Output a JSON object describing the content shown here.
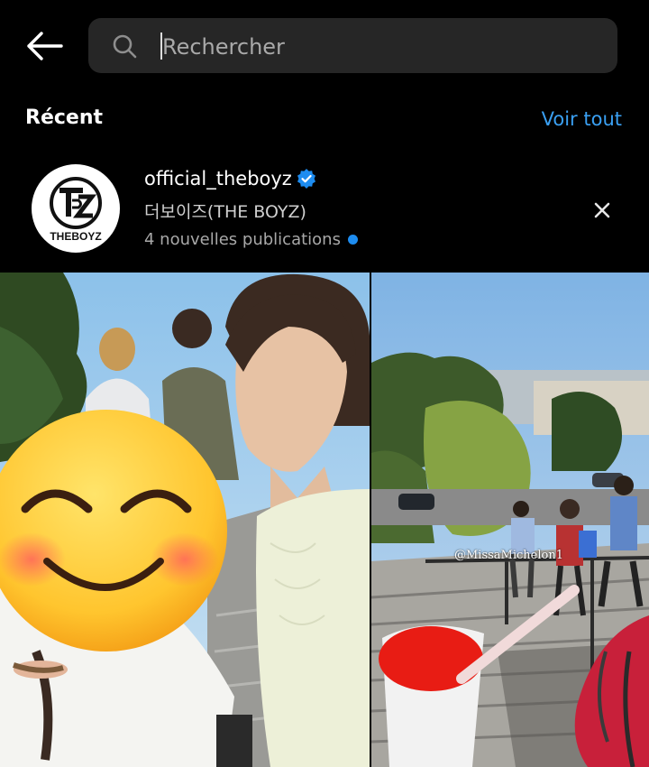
{
  "search": {
    "placeholder": "Rechercher",
    "value": ""
  },
  "recent": {
    "title": "Récent",
    "see_all": "Voir tout",
    "account": {
      "username": "official_theboyz",
      "full_name": "더보이즈(THE BOYZ)",
      "new_posts": "4 nouvelles publications",
      "avatar_logo_text": "THEBOYZ",
      "verified": true
    }
  },
  "results": {
    "tiles": [
      {
        "description": "selfie-photo"
      },
      {
        "description": "staircase-view-photo",
        "watermark": "@MissaMichelon1"
      }
    ]
  },
  "colors": {
    "background": "#000000",
    "accent": "#3aa0f3",
    "search_bg": "#262626",
    "verified": "#1d8cf0"
  }
}
